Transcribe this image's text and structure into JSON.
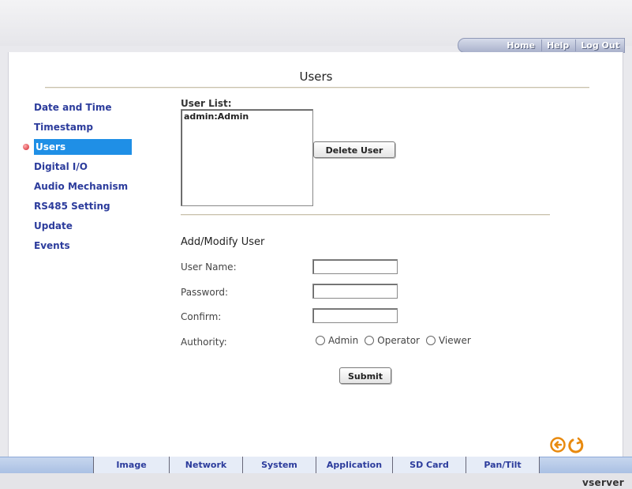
{
  "top_nav": {
    "home": "Home",
    "help": "Help",
    "logout": "Log Out"
  },
  "page": {
    "title": "Users"
  },
  "sidebar": {
    "items": [
      {
        "label": "Date and Time",
        "active": false
      },
      {
        "label": "Timestamp",
        "active": false
      },
      {
        "label": "Users",
        "active": true
      },
      {
        "label": "Digital I/O",
        "active": false
      },
      {
        "label": "Audio Mechanism",
        "active": false
      },
      {
        "label": "RS485 Setting",
        "active": false
      },
      {
        "label": "Update",
        "active": false
      },
      {
        "label": "Events",
        "active": false
      }
    ]
  },
  "user_list": {
    "label": "User List:",
    "entries": [
      "admin:Admin"
    ],
    "delete_label": "Delete User"
  },
  "form": {
    "section_title": "Add/Modify User",
    "username_label": "User Name:",
    "username_value": "",
    "password_label": "Password:",
    "password_value": "",
    "confirm_label": "Confirm:",
    "confirm_value": "",
    "authority_label": "Authority:",
    "authority_options": [
      "Admin",
      "Operator",
      "Viewer"
    ],
    "submit_label": "Submit"
  },
  "bottom_tabs": [
    "Image",
    "Network",
    "System",
    "Application",
    "SD Card",
    "Pan/Tilt"
  ],
  "brand": "vserver",
  "colors": {
    "accent": "#2c3c9c",
    "active_bg": "#1f8fe6",
    "nav_icon": "#e88a0f"
  }
}
